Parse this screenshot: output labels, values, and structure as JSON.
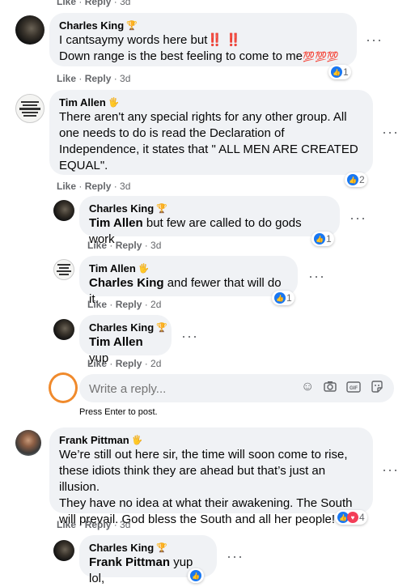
{
  "top_meta": {
    "like": "Like",
    "sep": "·",
    "reply": "Reply",
    "time": "· 3d"
  },
  "comments": [
    {
      "author": "Charles King",
      "badge": "🏆",
      "line1": "I cantsaymy words here but",
      "line1_emoji": "‼️ ‼️",
      "line2": "Down range is the best feeling to come to me",
      "line2_emoji": "💯💯💯",
      "like": "Like",
      "reply": "Reply",
      "time": "3d",
      "reactions": "1"
    },
    {
      "author": "Tim Allen",
      "badge": "🖐",
      "lines": [
        "There aren't any special rights for any other group. All",
        "one needs to do is read the Declaration of",
        "Independence, it states that \" ALL MEN ARE CREATED",
        "EQUAL\"."
      ],
      "like": "Like",
      "reply": "Reply",
      "time": "3d",
      "reactions": "2",
      "replies": [
        {
          "author": "Charles King",
          "badge": "🏆",
          "tag": "Tim Allen",
          "text": " but few are called to do gods work",
          "like": "Like",
          "reply": "Reply",
          "time": "3d",
          "reactions": "1"
        },
        {
          "author": "Tim Allen",
          "badge": "🖐",
          "tag": "Charles King",
          "text": " and fewer that will do it.",
          "like": "Like",
          "reply": "Reply",
          "time": "2d",
          "reactions": "1"
        },
        {
          "author": "Charles King",
          "badge": "🏆",
          "tag": "Tim Allen",
          "text": " yup",
          "like": "Like",
          "reply": "Reply",
          "time": "2d"
        }
      ]
    },
    {
      "author": "Frank Pittman",
      "badge": "🖐",
      "lines": [
        "We’re still out here sir, the time will soon come to rise,",
        "these idiots think they are ahead but that’s just an illusion.",
        "They have no idea at what their awakening. The South",
        "will prevail. God bless the South and all her people!"
      ],
      "like": "Like",
      "reply": "Reply",
      "time": "3d",
      "reactions": "4",
      "replies": [
        {
          "author": "Charles King",
          "badge": "🏆",
          "tag": "Frank Pittman",
          "text": " yup lol,"
        }
      ]
    }
  ],
  "reply_box": {
    "placeholder": "Write a reply...",
    "hint": "Press Enter to post."
  },
  "colors": {
    "accent": "#1877f2",
    "bubble": "#f0f2f5",
    "highlight_ring": "#f08a2c",
    "love": "#f33e58"
  },
  "icons": [
    "thumbs-up-icon",
    "heart-icon",
    "emoji-icon",
    "camera-icon",
    "gif-icon",
    "sticker-icon",
    "more-dots-icon"
  ]
}
